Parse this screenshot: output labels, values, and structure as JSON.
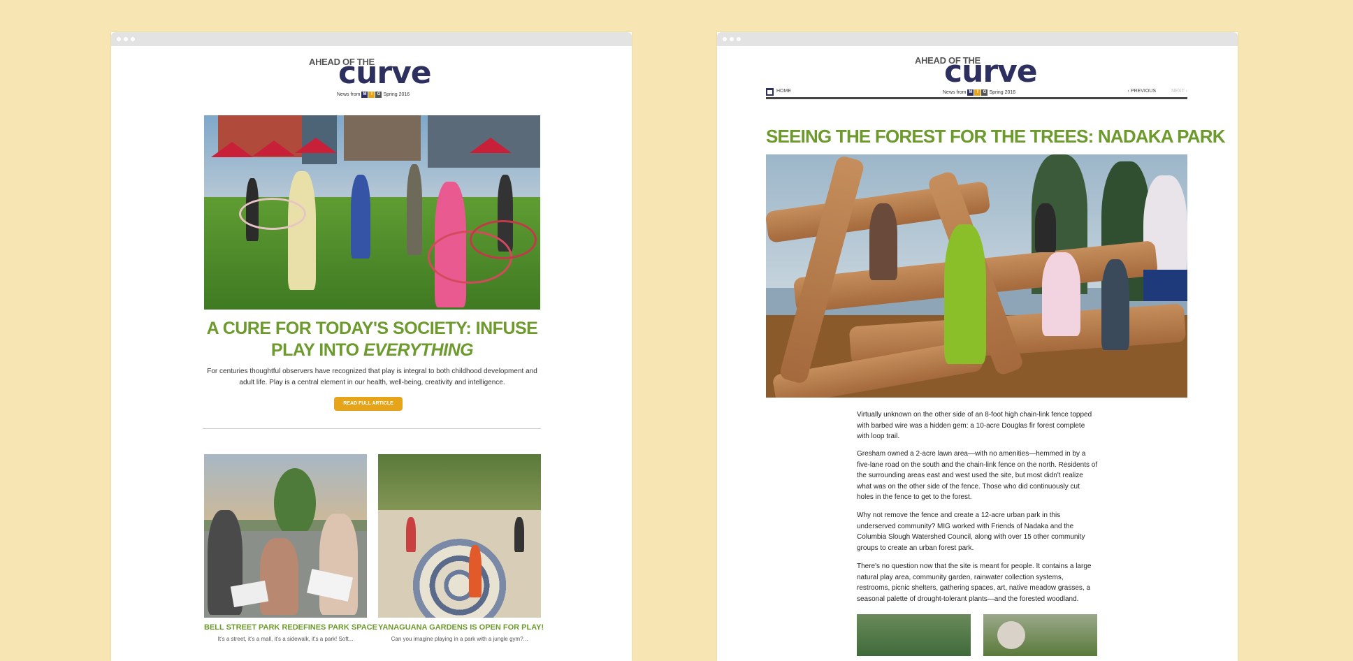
{
  "left": {
    "brand": {
      "pre": "AHEAD OF THE",
      "word": "curve",
      "sub_prefix": "News from",
      "mig": [
        "M",
        "I",
        "G"
      ],
      "sub_suffix": "Spring 2016"
    },
    "hero": {
      "title_main": "A CURE FOR TODAY'S SOCIETY: INFUSE PLAY INTO ",
      "title_em": "EVERYTHING",
      "summary": "For centuries thoughtful observers have recognized that play is integral to both childhood development and adult life. Play is a central element in our health, well-being, creativity and intelligence.",
      "button": "READ FULL ARTICLE"
    },
    "cards": [
      {
        "title": "BELL STREET PARK REDEFINES PARK SPACE",
        "snippet": "It's a street, it's a mall, it's a sidewalk, it's a park! Soft..."
      },
      {
        "title": "YANAGUANA GARDENS IS OPEN FOR PLAY!",
        "snippet": "Can you imagine playing in a park with a jungle gym?..."
      }
    ]
  },
  "right": {
    "brand": {
      "pre": "AHEAD OF THE",
      "word": "curve",
      "sub_prefix": "News from",
      "mig": [
        "M",
        "I",
        "G"
      ],
      "sub_suffix": "Spring 2016"
    },
    "nav": {
      "home": "HOME",
      "previous": "PREVIOUS",
      "next": "NEXT"
    },
    "article": {
      "title": "SEEING THE FOREST FOR THE TREES: NADAKA PARK",
      "paragraphs": [
        "Virtually unknown on the other side of an 8-foot high chain-link fence topped with barbed wire was a hidden gem: a 10-acre Douglas fir forest complete with loop trail.",
        "Gresham owned a 2-acre lawn area—with no amenities—hemmed in by a five-lane road on the south and the chain-link fence on the north. Residents of the surrounding areas east and west used the site, but most didn't realize what was on the other side of the fence. Those who did continuously cut holes in the fence to get to the forest.",
        "Why not remove the fence and create a 12-acre urban park in this underserved community? MIG worked with Friends of Nadaka and the Columbia Slough Watershed Council, along with over 15 other community groups to create an urban forest park.",
        "There's no question now that the site is meant for people. It contains a large natural play area, community garden, rainwater collection systems, restrooms, picnic shelters, gathering spaces, art, native meadow grasses, a seasonal palette of drought-tolerant plants—and the forested woodland."
      ]
    }
  },
  "colors": {
    "background": "#f7e6b4",
    "accent_green": "#6c9a2c",
    "brand_navy": "#2d2f5e",
    "button_gold": "#e6a41b"
  }
}
